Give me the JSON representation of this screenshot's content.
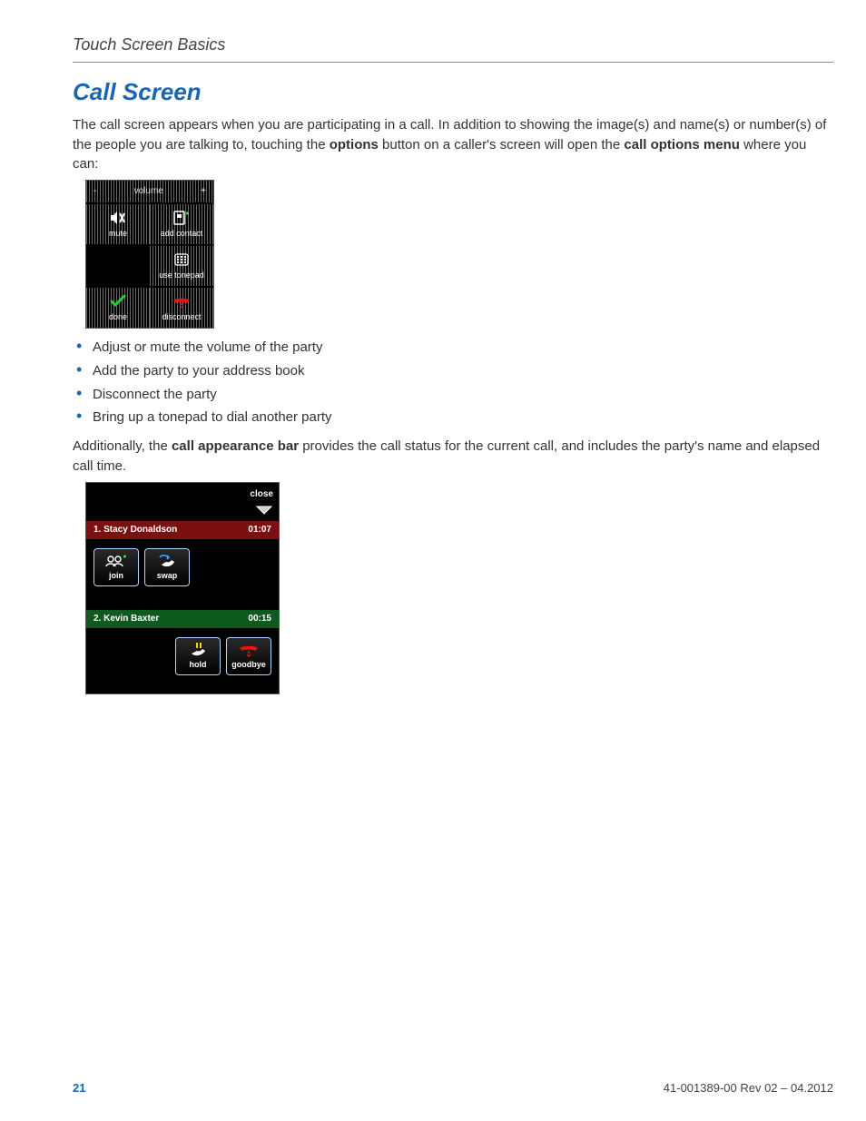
{
  "header": {
    "running_title": "Touch Screen Basics"
  },
  "section": {
    "title": "Call Screen"
  },
  "paragraphs": {
    "intro_pre": "The call screen appears when you are participating in a call. In addition to showing the image(s) and name(s) or number(s) of the people you are talking to, touching the ",
    "intro_bold1": "options",
    "intro_mid": " button on a caller's screen will open the ",
    "intro_bold2": "call options menu",
    "intro_post": " where you can:",
    "additional_pre": "Additionally, the ",
    "additional_bold": "call appearance bar",
    "additional_post": " provides the call status for the current call, and includes the party's name and elapsed call time."
  },
  "bullets": [
    "Adjust or mute the volume of the party",
    "Add the party to your address book",
    "Disconnect the party",
    "Bring up a tonepad to dial another party"
  ],
  "device1": {
    "volume_minus": "-",
    "volume_label": "volume",
    "volume_plus": "+",
    "mute": "mute",
    "add_contact": "add contact",
    "use_tonepad": "use tonepad",
    "done": "done",
    "disconnect": "disconnect"
  },
  "device2": {
    "close": "close",
    "calls": [
      {
        "name": "1. Stacy Donaldson",
        "time": "01:07"
      },
      {
        "name": "2. Kevin Baxter",
        "time": "00:15"
      }
    ],
    "join": "join",
    "swap": "swap",
    "hold": "hold",
    "goodbye": "goodbye"
  },
  "footer": {
    "page": "21",
    "docrev": "41-001389-00 Rev 02 – 04.2012"
  }
}
